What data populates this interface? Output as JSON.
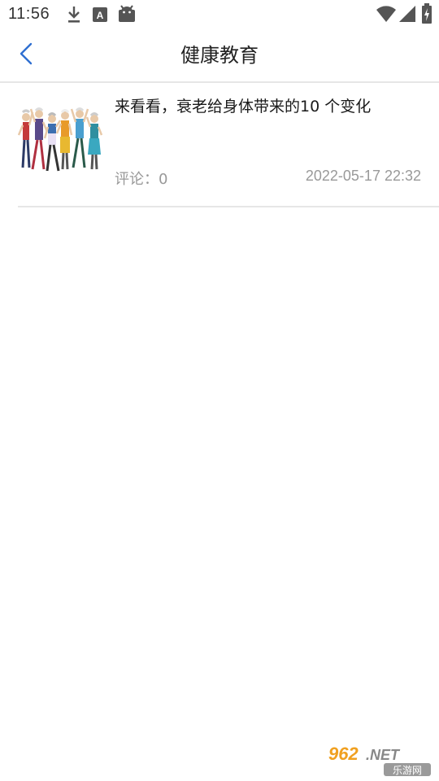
{
  "status_bar": {
    "time": "11:56",
    "icons": [
      "download-icon",
      "app-a-icon",
      "android-icon",
      "wifi-icon",
      "signal-icon",
      "battery-charging-icon"
    ]
  },
  "header": {
    "title": "健康教育",
    "back_icon": "chevron-left-icon",
    "accent_color": "#2f6fd1"
  },
  "articles": [
    {
      "title": "来看看，衰老给身体带来的10 个变化",
      "comments": "评论：0",
      "date": "2022-05-17 22:32",
      "thumbnail_icon": "elderly-people-dancing-image"
    }
  ],
  "watermark": {
    "number": "962",
    "suffix": ".NET",
    "sub": "乐游网"
  }
}
